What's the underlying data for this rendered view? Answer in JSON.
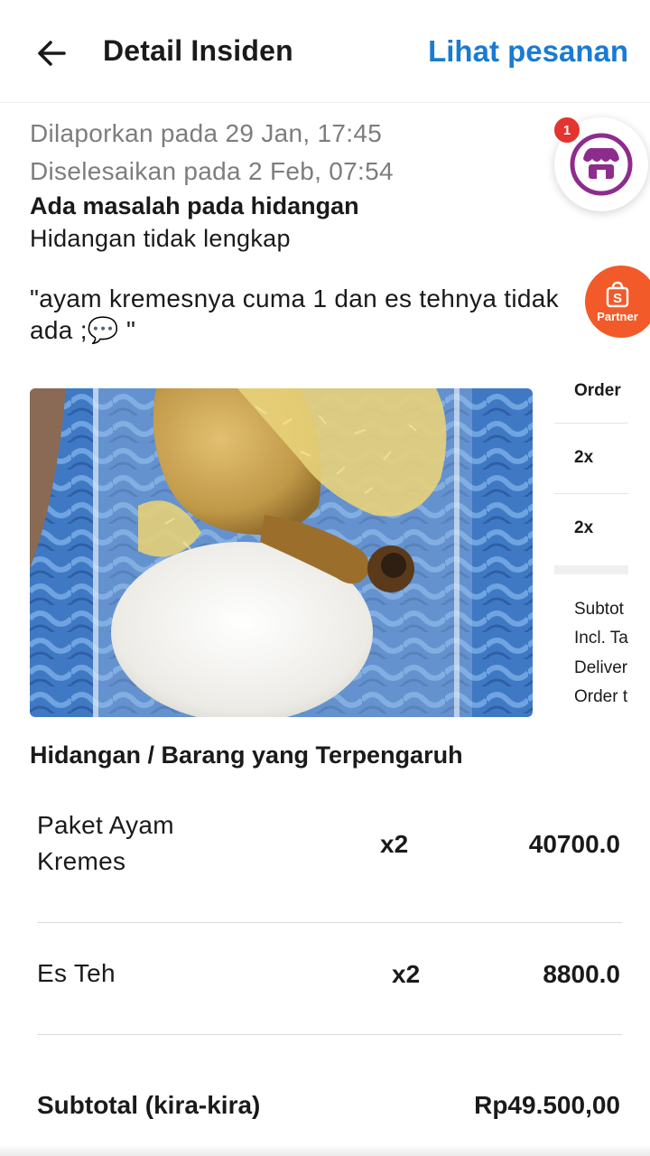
{
  "header": {
    "title": "Detail Insiden",
    "order_link": "Lihat pesanan"
  },
  "incident": {
    "reported": "Dilaporkan pada 29 Jan, 17:45",
    "resolved": "Diselesaikan pada 2 Feb, 07:54",
    "issue_title": "Ada masalah pada hidangan",
    "issue_detail": "Hidangan tidak lengkap",
    "comment": "\"ayam kremesnya cuma 1 dan es tehnya tidak ada ;💬 \""
  },
  "floating": {
    "badge_count": "1",
    "partner_label": "Partner",
    "partner_letter": "S"
  },
  "peek_panel": {
    "heading": "Order",
    "rows": [
      "2x",
      "2x"
    ],
    "summary": [
      "Subtot",
      "Incl. Ta",
      "Deliver",
      "Order t"
    ]
  },
  "affected": {
    "title": "Hidangan / Barang yang Terpengaruh",
    "items": [
      {
        "name": "Paket Ayam Kremes",
        "qty": "x2",
        "price": "40700.0"
      },
      {
        "name": "Es Teh",
        "qty": "x2",
        "price": "8800.0"
      }
    ],
    "subtotal_label": "Subtotal (kira-kira)",
    "subtotal_value": "Rp49.500,00"
  },
  "colors": {
    "accent_link": "#1a7bd0",
    "muted_text": "#7d7d7d",
    "badge_red": "#e3342f",
    "partner_orange": "#f25a2a",
    "shop_purple": "#8e2c8e"
  },
  "icons": [
    "back-arrow-icon",
    "shop-icon",
    "partner-bag-icon"
  ]
}
